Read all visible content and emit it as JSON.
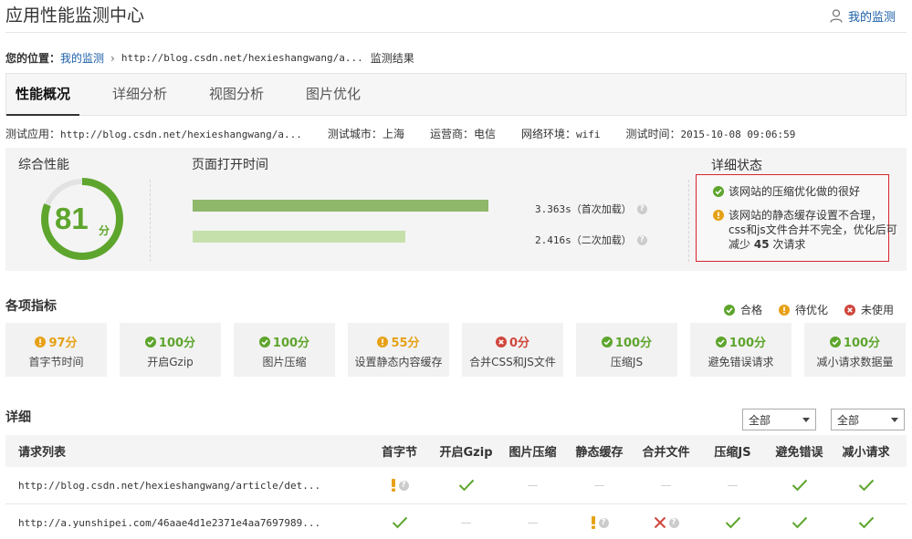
{
  "app_title": "应用性能监测中心",
  "header_link": "我的监测",
  "breadcrumb": {
    "label": "您的位置：",
    "link": "我的监测",
    "url": "http://blog.csdn.net/hexieshangwang/a...",
    "current": "监测结果"
  },
  "tabs": [
    "性能概况",
    "详细分析",
    "视图分析",
    "图片优化"
  ],
  "info": [
    {
      "label": "测试应用：",
      "value": "http://blog.csdn.net/hexieshangwang/a..."
    },
    {
      "label": "测试城市：",
      "value": "上海"
    },
    {
      "label": "运营商：",
      "value": "电信"
    },
    {
      "label": "网络环境：",
      "value": "wifi"
    },
    {
      "label": "测试时间：",
      "value": "2015-10-08 09:06:59"
    }
  ],
  "overall": {
    "title": "综合性能",
    "score": 81,
    "score_text": "81",
    "unit": "分"
  },
  "load_time": {
    "title": "页面打开时间",
    "bars": [
      {
        "seconds": 3.363,
        "label": "3.363s（首次加载）"
      },
      {
        "seconds": 2.416,
        "label": "2.416s（二次加载）"
      }
    ]
  },
  "detail_status": {
    "title": "详细状态",
    "good_text": "该网站的压缩优化做的很好",
    "warn_line1": "该网站的静态缓存设置不合理，",
    "warn_line2": "css和js文件合并不完全，优化后可",
    "warn_line3_pre": "减少",
    "warn_count": "45",
    "warn_line3_post": "次请求"
  },
  "metrics_title": "各项指标",
  "legend": {
    "pass": "合格",
    "warn": "待优化",
    "fail": "未使用"
  },
  "metrics": [
    {
      "status": "warn",
      "score": "97分",
      "name": "首字节时间"
    },
    {
      "status": "pass",
      "score": "100分",
      "name": "开启Gzip"
    },
    {
      "status": "pass",
      "score": "100分",
      "name": "图片压缩"
    },
    {
      "status": "warn",
      "score": "55分",
      "name": "设置静态内容缓存"
    },
    {
      "status": "fail",
      "score": "0分",
      "name": "合并CSS和JS文件"
    },
    {
      "status": "pass",
      "score": "100分",
      "name": "压缩JS"
    },
    {
      "status": "pass",
      "score": "100分",
      "name": "避免错误请求"
    },
    {
      "status": "pass",
      "score": "100分",
      "name": "减小请求数据量"
    }
  ],
  "detail_title": "详细",
  "filters": [
    "全部",
    "全部"
  ],
  "table": {
    "headers": [
      "请求列表",
      "首字节",
      "开启Gzip",
      "图片压缩",
      "静态缓存",
      "合并文件",
      "压缩JS",
      "避免错误",
      "减小请求"
    ],
    "rows": [
      {
        "url": "http://blog.csdn.net/hexieshangwang/article/det...",
        "cells": [
          "warn",
          "pass",
          "none",
          "none",
          "none",
          "none",
          "pass",
          "pass"
        ]
      },
      {
        "url": "http://a.yunshipei.com/46aae4d1e2371e4aa7697989...",
        "cells": [
          "pass",
          "none",
          "none",
          "warn",
          "fail",
          "pass",
          "pass",
          "pass"
        ]
      }
    ]
  },
  "colors": {
    "pass": "#5ea52d",
    "warn": "#e6a117",
    "fail": "#d0463c",
    "link": "#1a5fa8",
    "alert_border": "#d9232d"
  }
}
